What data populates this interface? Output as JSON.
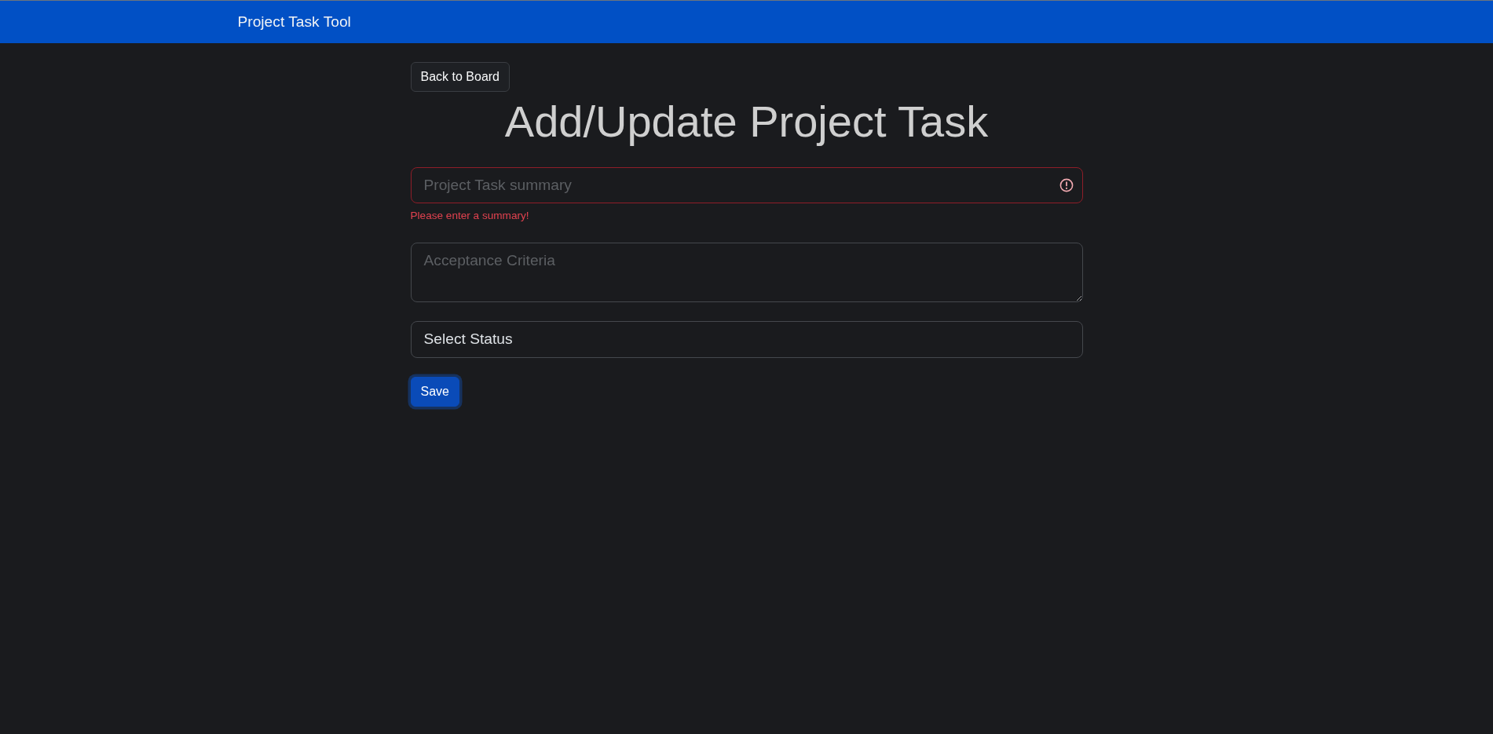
{
  "navbar": {
    "brand": "Project Task Tool"
  },
  "back_button": {
    "label": "Back to Board"
  },
  "title": "Add/Update Project Task",
  "form": {
    "fields": [
      {
        "kind": "input",
        "placeholder": "Project Task summary",
        "invalid": true,
        "feedback": "Please enter a summary!"
      },
      {
        "kind": "textarea",
        "placeholder": "Acceptance Criteria",
        "invalid": false
      },
      {
        "kind": "select",
        "value": "Select Status",
        "invalid": false
      }
    ],
    "submit": {
      "label": "Save",
      "focused": true
    }
  }
}
